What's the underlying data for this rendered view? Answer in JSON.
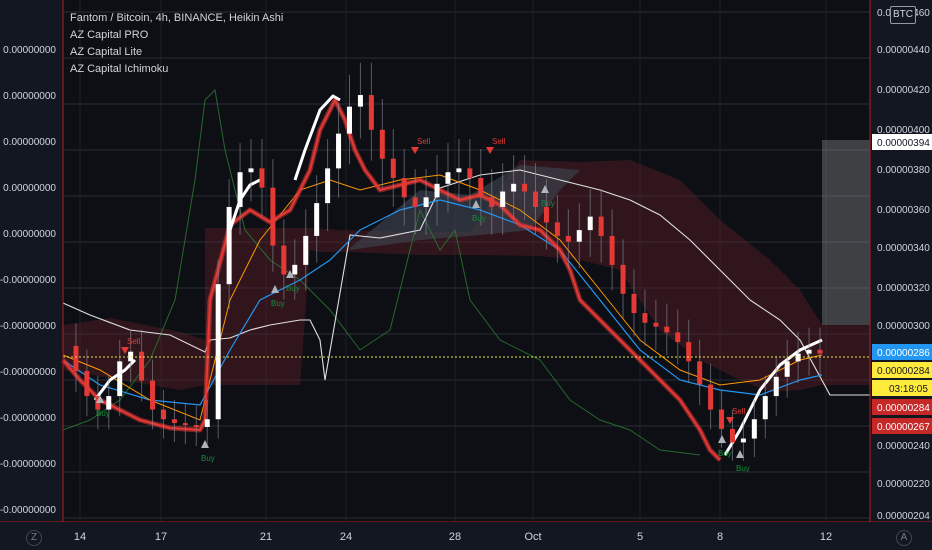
{
  "header": {
    "symbol_line": "Fantom / Bitcoin, 4h, BINANCE, Heikin Ashi",
    "indicators": [
      "AZ Capital PRO",
      "AZ Capital Lite",
      "AZ Capital Ichimoku"
    ],
    "currency_badge": "BTC"
  },
  "bottom_controls": {
    "left_icon": "Z",
    "right_icon": "A"
  },
  "colors": {
    "background": "#131722",
    "bull_candle": "#ffffff",
    "bear_candle": "#e53935",
    "cloud_bear": "#5b1f26",
    "cloud_bull": "#3b3f4a",
    "price_line": "#e3e354",
    "buy_signal": "#1b8a3a",
    "sell_signal": "#e53935"
  },
  "chart_data": {
    "type": "candlestick",
    "title": "Fantom / Bitcoin, 4h, BINANCE, Heikin Ashi",
    "x_ticks": [
      "14",
      "17",
      "21",
      "24",
      "28",
      "Oct",
      "5",
      "8",
      "12"
    ],
    "right_axis": {
      "ticks": [
        "0.00000460",
        "0.00000440",
        "0.00000420",
        "0.00000400",
        "0.00000380",
        "0.00000360",
        "0.00000340",
        "0.00000320",
        "0.00000300",
        "0.00000240",
        "0.00000220",
        "0.00000204"
      ],
      "ylim": [
        2.04e-06,
        4.6e-06
      ]
    },
    "left_axis": {
      "ticks": [
        "0.00000000",
        "0.00000000",
        "0.00000000",
        "0.00000000",
        "0.00000000",
        "-0.00000000",
        "-0.00000000",
        "-0.00000000",
        "-0.00000000",
        "-0.00000000",
        "-0.00000000",
        "-0.00000001",
        "-0.00000001"
      ]
    },
    "price_labels": [
      {
        "value": "0.00000394",
        "color": "#ffffff",
        "text_color": "#131722"
      },
      {
        "value": "0.00000286",
        "color": "#2196f3",
        "text_color": "#ffffff"
      },
      {
        "value": "0.00000284",
        "color": "#ffeb3b",
        "text_color": "#131722"
      },
      {
        "value": "03:18:05",
        "color": "#ffeb3b",
        "text_color": "#131722"
      },
      {
        "value": "0.00000284",
        "color": "#c62828",
        "text_color": "#ffffff"
      },
      {
        "value": "0.00000267",
        "color": "#c62828",
        "text_color": "#ffffff"
      }
    ],
    "signals": [
      {
        "type": "Buy",
        "date_index": 12
      },
      {
        "type": "Buy",
        "date_index": 48
      },
      {
        "type": "Buy",
        "date_index": 78
      },
      {
        "type": "Sell",
        "date_index": 22
      },
      {
        "type": "Sell",
        "date_index": 122
      },
      {
        "type": "Sell",
        "date_index": 145
      },
      {
        "type": "Buy",
        "date_index": 210
      }
    ],
    "close_series": [
      2.88e-06,
      2.75e-06,
      2.62e-06,
      2.55e-06,
      2.62e-06,
      2.8e-06,
      2.85e-06,
      2.7e-06,
      2.55e-06,
      2.5e-06,
      2.48e-06,
      2.47e-06,
      2.46e-06,
      2.5e-06,
      3.2e-06,
      3.6e-06,
      3.78e-06,
      3.8e-06,
      3.7e-06,
      3.4e-06,
      3.25e-06,
      3.3e-06,
      3.45e-06,
      3.62e-06,
      3.8e-06,
      3.98e-06,
      4.12e-06,
      4.18e-06,
      4e-06,
      3.85e-06,
      3.75e-06,
      3.65e-06,
      3.6e-06,
      3.65e-06,
      3.72e-06,
      3.78e-06,
      3.8e-06,
      3.75e-06,
      3.65e-06,
      3.6e-06,
      3.68e-06,
      3.72e-06,
      3.68e-06,
      3.6e-06,
      3.52e-06,
      3.45e-06,
      3.42e-06,
      3.48e-06,
      3.55e-06,
      3.45e-06,
      3.3e-06,
      3.15e-06,
      3.05e-06,
      3e-06,
      2.98e-06,
      2.95e-06,
      2.9e-06,
      2.8e-06,
      2.68e-06,
      2.55e-06,
      2.45e-06,
      2.38e-06,
      2.4e-06,
      2.5e-06,
      2.62e-06,
      2.72e-06,
      2.8e-06,
      2.84e-06,
      2.86e-06,
      2.84e-06
    ],
    "series": [
      {
        "name": "AZ Capital PRO"
      },
      {
        "name": "AZ Capital Lite"
      },
      {
        "name": "AZ Capital Ichimoku"
      }
    ],
    "grid": true
  }
}
